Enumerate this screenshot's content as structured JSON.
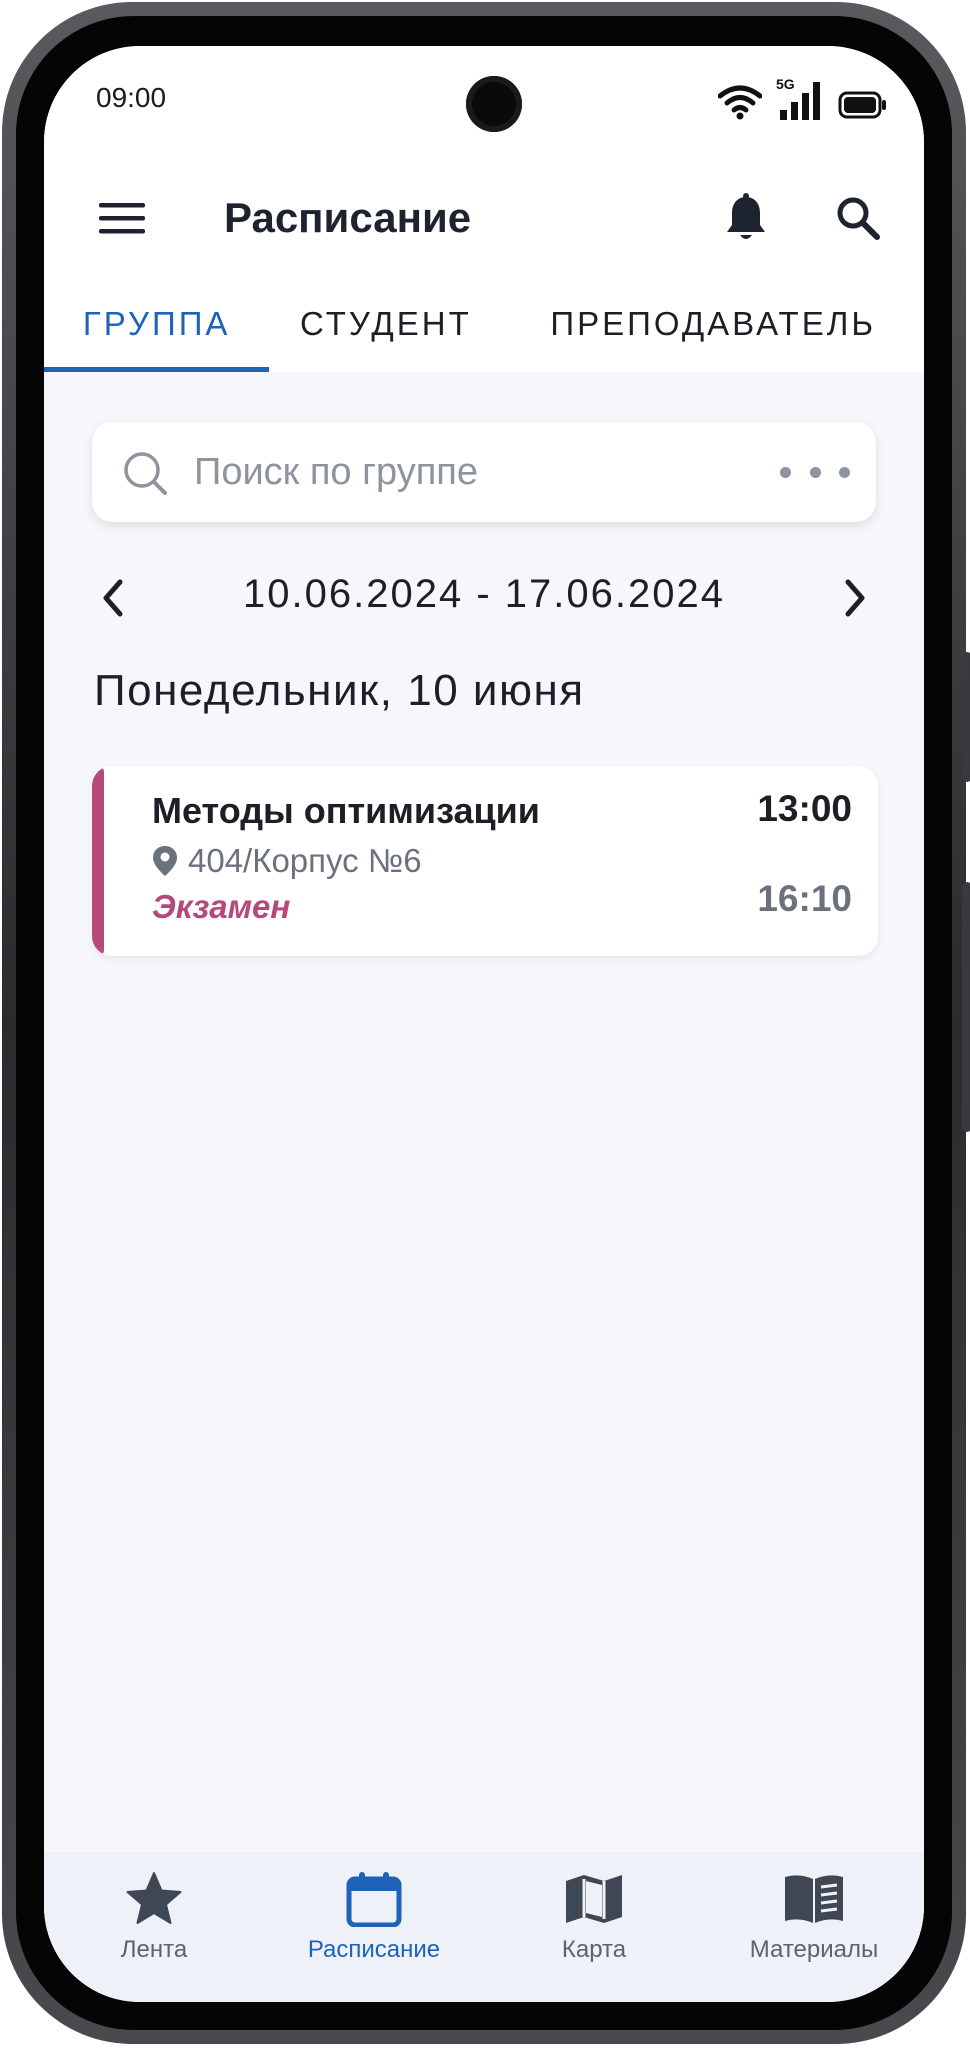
{
  "status_bar": {
    "time": "09:00",
    "network": "5G"
  },
  "app_bar": {
    "title": "Расписание",
    "icons": [
      "menu-icon",
      "bell-icon",
      "search-icon"
    ]
  },
  "tabs": [
    {
      "label": "ГРУППА",
      "active": true
    },
    {
      "label": "СТУДЕНТ",
      "active": false
    },
    {
      "label": "ПРЕПОДАВАТЕЛЬ",
      "active": false
    }
  ],
  "search": {
    "placeholder": "Поиск по группе",
    "value": ""
  },
  "week": {
    "range": "10.06.2024 - 17.06.2024"
  },
  "schedule": {
    "day_title": "Понедельник, 10 июня",
    "lessons": [
      {
        "name": "Методы оптимизации",
        "place": "404/Корпус №6",
        "type": "Экзамен",
        "start": "13:00",
        "end": "16:10"
      }
    ]
  },
  "bottom_nav": [
    {
      "label": "Лента",
      "icon": "star-icon",
      "active": false
    },
    {
      "label": "Расписание",
      "icon": "calendar-icon",
      "active": true
    },
    {
      "label": "Карта",
      "icon": "map-icon",
      "active": false
    },
    {
      "label": "Материалы",
      "icon": "book-icon",
      "active": false
    }
  ],
  "colors": {
    "accent": "#1e63b8",
    "exam": "#b54a7a",
    "background": "#f5f7fc"
  }
}
